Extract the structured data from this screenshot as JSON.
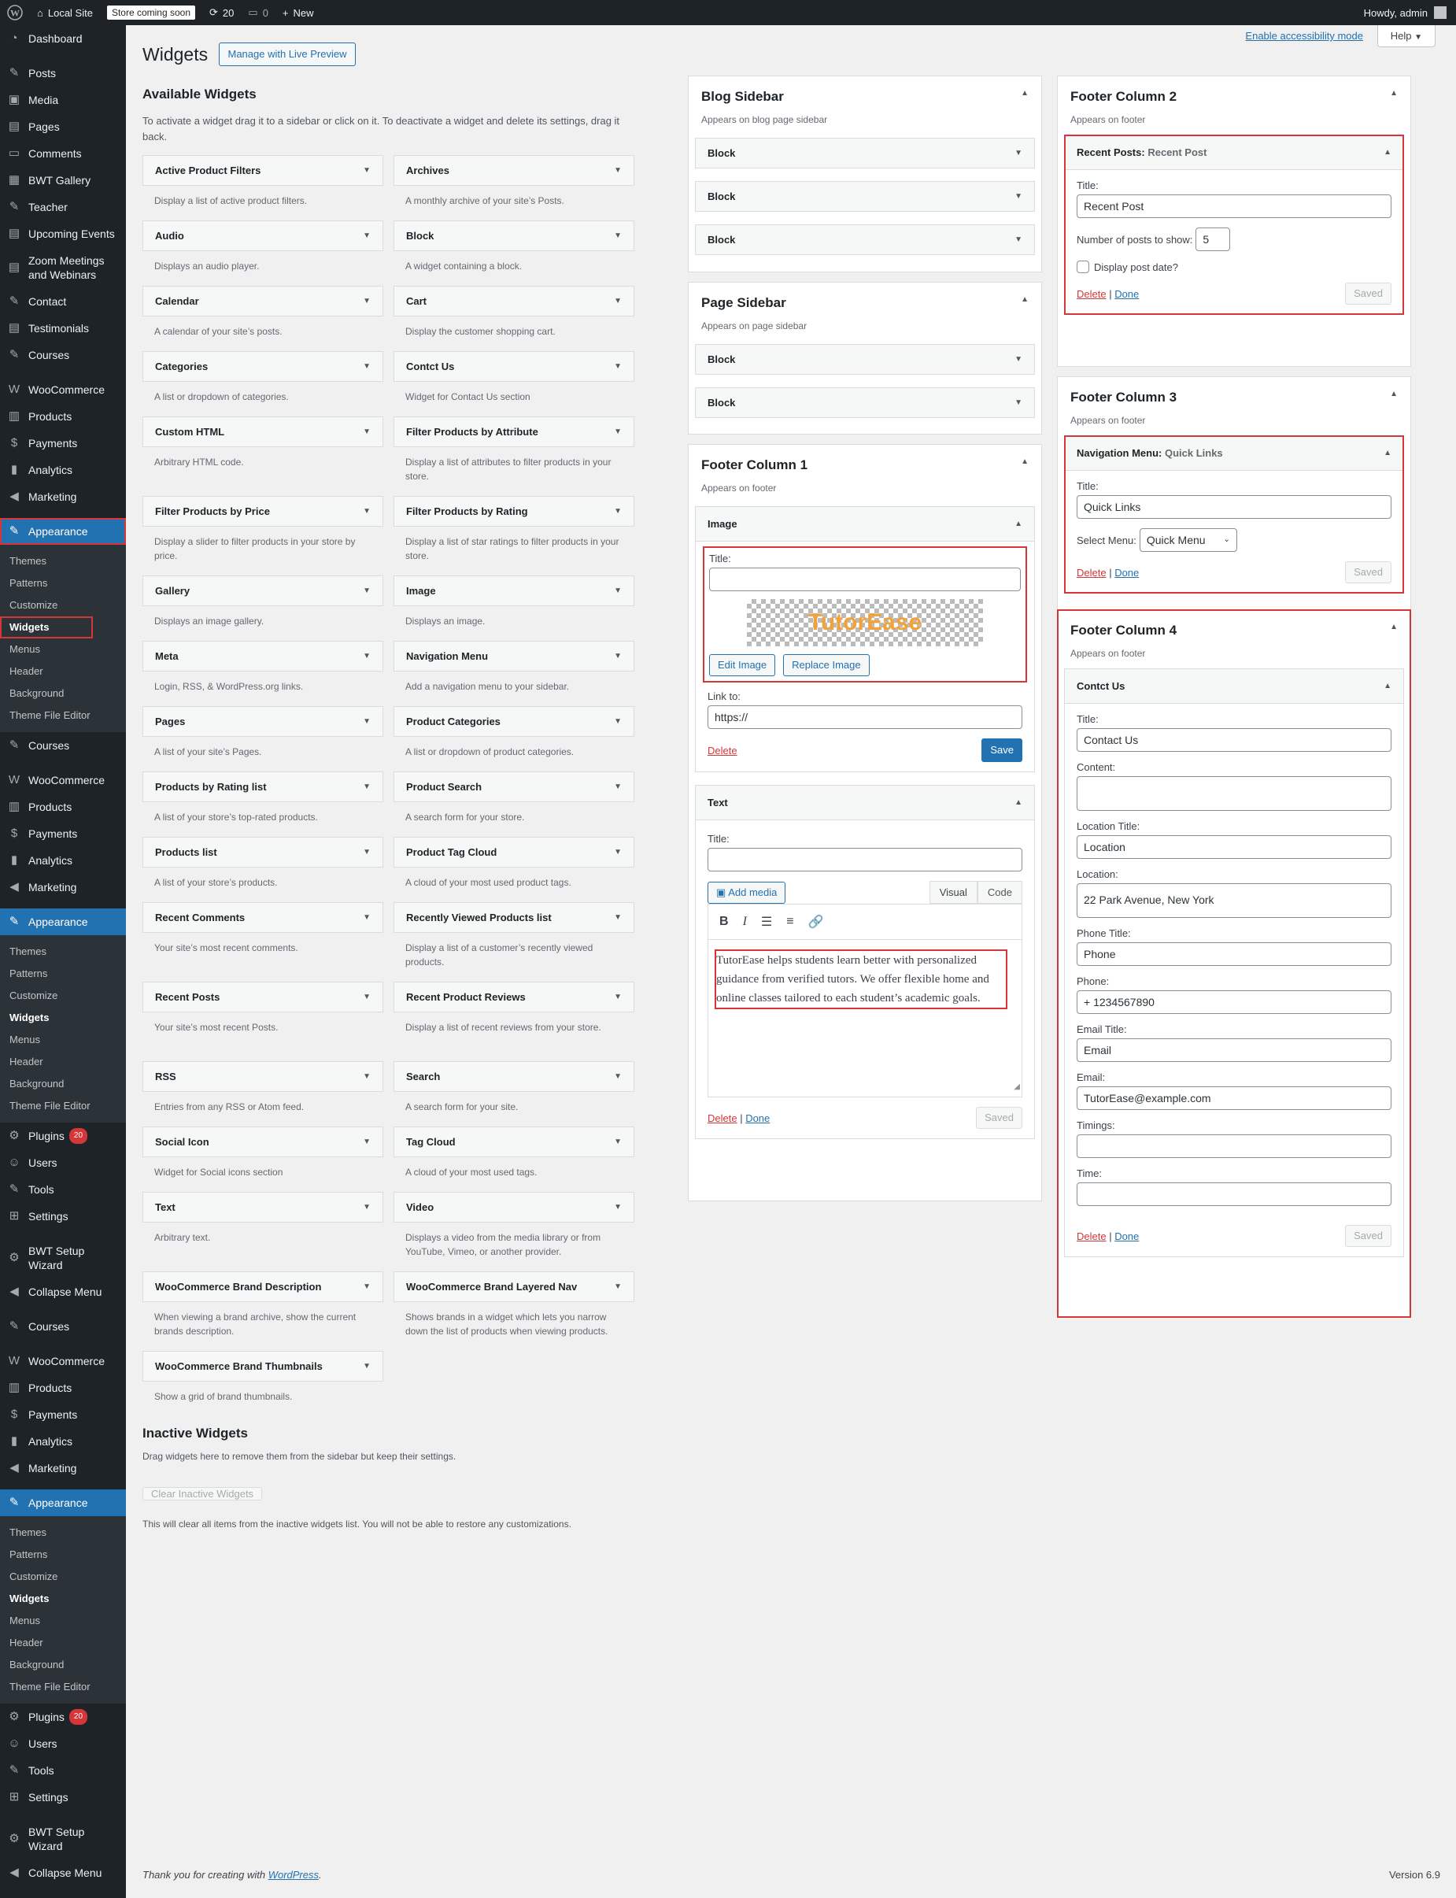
{
  "adminbar": {
    "site_name": "Local Site",
    "store_badge": "Store coming soon",
    "updates": "20",
    "comments": "0",
    "new_label": "New",
    "howdy": "Howdy, admin"
  },
  "sidebar": {
    "top": [
      "Dashboard"
    ],
    "group1": [
      "Posts",
      "Media",
      "Pages",
      "Comments",
      "BWT Gallery",
      "Teacher",
      "Upcoming Events",
      "Zoom Meetings and Webinars",
      "Contact",
      "Testimonials",
      "Courses"
    ],
    "woo_group": [
      "WooCommerce",
      "Products",
      "Payments",
      "Analytics",
      "Marketing"
    ],
    "appearance": "Appearance",
    "appearance_sub": [
      "Themes",
      "Patterns",
      "Customize",
      "Widgets",
      "Menus",
      "Header",
      "Background",
      "Theme File Editor"
    ],
    "tail": [
      "Plugins",
      "Users",
      "Tools",
      "Settings"
    ],
    "plugins_badge": "20",
    "setup_wizard": "BWT Setup Wizard",
    "collapse": "Collapse Menu",
    "courses": "Courses"
  },
  "header": {
    "title": "Widgets",
    "live_preview": "Manage with Live Preview",
    "a11y_link": "Enable accessibility mode",
    "help": "Help"
  },
  "available": {
    "title": "Available Widgets",
    "description": "To activate a widget drag it to a sidebar or click on it. To deactivate a widget and delete its settings, drag it back.",
    "widgets": [
      {
        "name": "Active Product Filters",
        "desc": "Display a list of active product filters."
      },
      {
        "name": "Archives",
        "desc": "A monthly archive of your site’s Posts."
      },
      {
        "name": "Audio",
        "desc": "Displays an audio player."
      },
      {
        "name": "Block",
        "desc": "A widget containing a block."
      },
      {
        "name": "Calendar",
        "desc": "A calendar of your site’s posts."
      },
      {
        "name": "Cart",
        "desc": "Display the customer shopping cart."
      },
      {
        "name": "Categories",
        "desc": "A list or dropdown of categories."
      },
      {
        "name": "Contct Us",
        "desc": "Widget for Contact Us section"
      },
      {
        "name": "Custom HTML",
        "desc": "Arbitrary HTML code."
      },
      {
        "name": "Filter Products by Attribute",
        "desc": "Display a list of attributes to filter products in your store."
      },
      {
        "name": "Filter Products by Price",
        "desc": "Display a slider to filter products in your store by price."
      },
      {
        "name": "Filter Products by Rating",
        "desc": "Display a list of star ratings to filter products in your store."
      },
      {
        "name": "Gallery",
        "desc": "Displays an image gallery."
      },
      {
        "name": "Image",
        "desc": "Displays an image."
      },
      {
        "name": "Meta",
        "desc": "Login, RSS, & WordPress.org links."
      },
      {
        "name": "Navigation Menu",
        "desc": "Add a navigation menu to your sidebar."
      },
      {
        "name": "Pages",
        "desc": "A list of your site’s Pages."
      },
      {
        "name": "Product Categories",
        "desc": "A list or dropdown of product categories."
      },
      {
        "name": "Products by Rating list",
        "desc": "A list of your store’s top-rated products."
      },
      {
        "name": "Product Search",
        "desc": "A search form for your store."
      },
      {
        "name": "Products list",
        "desc": "A list of your store’s products."
      },
      {
        "name": "Product Tag Cloud",
        "desc": "A cloud of your most used product tags."
      },
      {
        "name": "Recent Comments",
        "desc": "Your site’s most recent comments."
      },
      {
        "name": "Recently Viewed Products list",
        "desc": "Display a list of a customer’s recently viewed products."
      },
      {
        "name": "Recent Posts",
        "desc": "Your site’s most recent Posts."
      },
      {
        "name": "Recent Product Reviews",
        "desc": "Display a list of recent reviews from your store."
      },
      {
        "name": "RSS",
        "desc": "Entries from any RSS or Atom feed."
      },
      {
        "name": "Search",
        "desc": "A search form for your site."
      },
      {
        "name": "Social Icon",
        "desc": "Widget for Social icons section"
      },
      {
        "name": "Tag Cloud",
        "desc": "A cloud of your most used tags."
      },
      {
        "name": "Text",
        "desc": "Arbitrary text."
      },
      {
        "name": "Video",
        "desc": "Displays a video from the media library or from YouTube, Vimeo, or another provider."
      },
      {
        "name": "WooCommerce Brand Description",
        "desc": "When viewing a brand archive, show the current brands description."
      },
      {
        "name": "WooCommerce Brand Layered Nav",
        "desc": "Shows brands in a widget which lets you narrow down the list of products when viewing products."
      },
      {
        "name": "WooCommerce Brand Thumbnails",
        "desc": "Show a grid of brand thumbnails."
      }
    ]
  },
  "inactive": {
    "title": "Inactive Widgets",
    "description": "Drag widgets here to remove them from the sidebar but keep their settings.",
    "clear_button": "Clear Inactive Widgets",
    "note": "This will clear all items from the inactive widgets list. You will not be able to restore any customizations."
  },
  "blog_sidebar": {
    "title": "Blog Sidebar",
    "desc": "Appears on blog page sidebar",
    "blocks": [
      "Block",
      "Block",
      "Block"
    ]
  },
  "page_sidebar": {
    "title": "Page Sidebar",
    "desc": "Appears on page sidebar",
    "blocks": [
      "Block",
      "Block"
    ]
  },
  "footer1": {
    "title": "Footer Column 1",
    "desc": "Appears on footer",
    "image_widget": {
      "title": "Image",
      "title_label": "Title:",
      "title_value": "",
      "logo_text": "TutorEase",
      "edit": "Edit Image",
      "replace": "Replace Image",
      "link_label": "Link to:",
      "link_value": "https://",
      "delete": "Delete",
      "save": "Save"
    },
    "text_widget": {
      "title": "Text",
      "title_label": "Title:",
      "title_value": "",
      "add_media": "Add media",
      "tab_visual": "Visual",
      "tab_code": "Code",
      "content": "TutorEase helps students learn better with personalized guidance from verified tutors. We offer flexible home and online classes tailored to each student’s academic goals.",
      "delete": "Delete",
      "done": "Done",
      "saved": "Saved"
    }
  },
  "footer2": {
    "title": "Footer Column 2",
    "desc": "Appears on footer",
    "widget_name": "Recent Posts:",
    "widget_sub": "Recent Post",
    "title_label": "Title:",
    "title_value": "Recent Post",
    "num_label": "Number of posts to show:",
    "num_value": "5",
    "date_label": "Display post date?",
    "delete": "Delete",
    "done": "Done",
    "saved": "Saved"
  },
  "footer3": {
    "title": "Footer Column 3",
    "desc": "Appears on footer",
    "widget_name": "Navigation Menu:",
    "widget_sub": "Quick Links",
    "title_label": "Title:",
    "title_value": "Quick Links",
    "menu_label": "Select Menu:",
    "menu_value": "Quick Menu",
    "delete": "Delete",
    "done": "Done",
    "saved": "Saved"
  },
  "footer4": {
    "title": "Footer Column 4",
    "desc": "Appears on footer",
    "widget_name": "Contct Us",
    "fields": [
      {
        "label": "Title:",
        "value": "Contact Us",
        "type": "input"
      },
      {
        "label": "Content:",
        "value": "",
        "type": "textarea"
      },
      {
        "label": "Location Title:",
        "value": "Location",
        "type": "input"
      },
      {
        "label": "Location:",
        "value": "22 Park Avenue, New York",
        "type": "textarea"
      },
      {
        "label": "Phone Title:",
        "value": "Phone",
        "type": "input"
      },
      {
        "label": "Phone:",
        "value": "+ 1234567890",
        "type": "input"
      },
      {
        "label": "Email Title:",
        "value": "Email",
        "type": "input"
      },
      {
        "label": "Email:",
        "value": "TutorEase@example.com",
        "type": "input"
      },
      {
        "label": "Timings:",
        "value": "",
        "type": "input"
      },
      {
        "label": "Time:",
        "value": "",
        "type": "input"
      }
    ],
    "delete": "Delete",
    "done": "Done",
    "saved": "Saved"
  },
  "footer": {
    "thanks_prefix": "Thank you for creating with ",
    "wp_link": "WordPress",
    "thanks_suffix": ".",
    "version": "Version 6.9"
  }
}
